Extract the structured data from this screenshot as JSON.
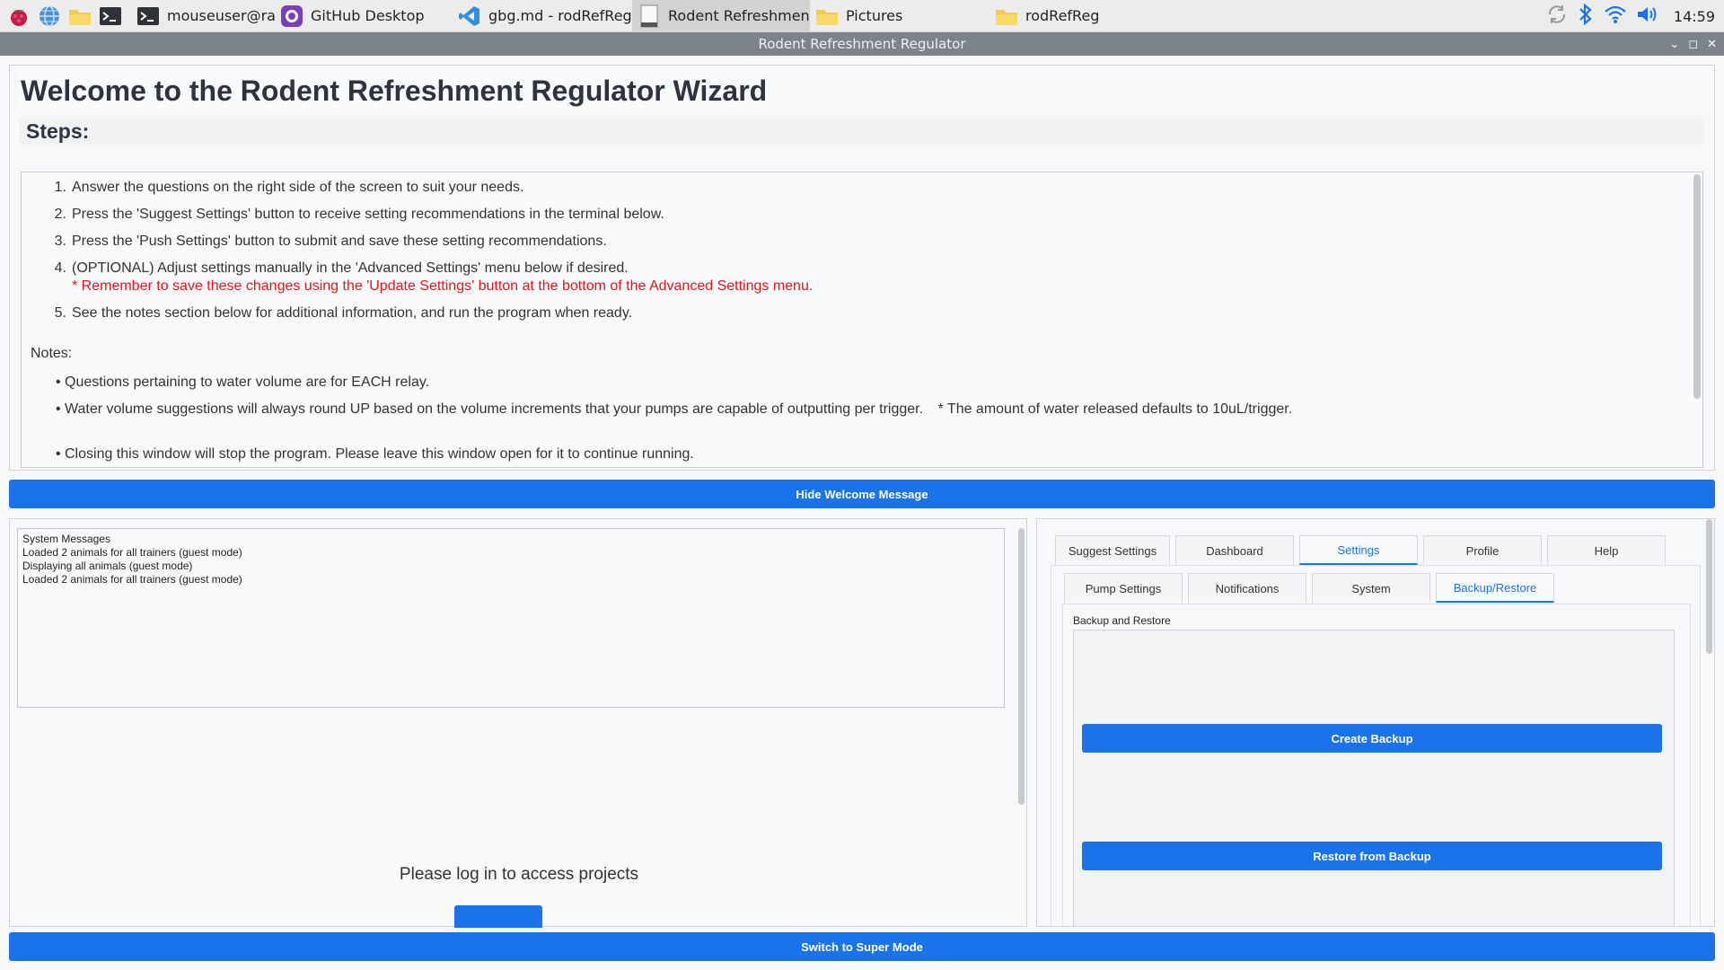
{
  "taskbar": {
    "tasks": [
      {
        "label": "mouseuser@raspber..",
        "icon": "terminal-icon"
      },
      {
        "label": "GitHub Desktop",
        "icon": "github-icon"
      },
      {
        "label": "gbg.md - rodRefReg ..",
        "icon": "vscode-icon"
      },
      {
        "label": "Rodent Refreshment ..",
        "icon": "window-icon"
      },
      {
        "label": "Pictures",
        "icon": "folder-icon"
      },
      {
        "label": "rodRefReg",
        "icon": "folder-icon"
      }
    ],
    "clock": "14:59",
    "accent": "#1a73e8"
  },
  "window": {
    "title": "Rodent Refreshment Regulator"
  },
  "welcome": {
    "title": "Welcome to the Rodent Refreshment Regulator Wizard",
    "steps_heading": "Steps:",
    "steps": [
      {
        "num": "1.",
        "text": "Answer the questions on the right side of the screen to suit your needs."
      },
      {
        "num": "2.",
        "text": "Press the 'Suggest Settings' button to receive setting recommendations in the terminal below."
      },
      {
        "num": "3.",
        "text": "Press the 'Push Settings' button to submit and save these setting recommendations."
      },
      {
        "num": "4.",
        "text": "(OPTIONAL) Adjust settings manually in the 'Advanced Settings' menu below if desired.",
        "warning": "* Remember to save these changes using the 'Update Settings' button at the bottom of the Advanced Settings menu."
      },
      {
        "num": "5.",
        "text": "See the notes section below for additional information, and run the program when ready."
      }
    ],
    "notes_label": "Notes:",
    "notes": [
      {
        "text": "Questions pertaining to water volume are for EACH relay."
      },
      {
        "text": "Water volume suggestions will always round UP based on the volume increments that your pumps are capable of outputting per trigger.",
        "info": "* The amount of water released defaults to 10uL/trigger."
      },
      {
        "text": "Closing this window will stop the program. Please leave this window open for it to continue running."
      }
    ],
    "hide_button": "Hide Welcome Message"
  },
  "system_messages": {
    "lines": [
      "System Messages",
      "Loaded 2 animals for all trainers (guest mode)",
      "Displaying all animals (guest mode)",
      "Loaded 2 animals for all trainers (guest mode)"
    ]
  },
  "projects": {
    "login_message": "Please log in to access projects"
  },
  "settings_panel": {
    "main_tabs": [
      "Suggest Settings",
      "Dashboard",
      "Settings",
      "Profile",
      "Help"
    ],
    "main_selected": "Settings",
    "sub_tabs": [
      "Pump Settings",
      "Notifications",
      "System",
      "Backup/Restore"
    ],
    "sub_selected": "Backup/Restore",
    "backup_label": "Backup and Restore",
    "create_backup": "Create Backup",
    "restore_backup": "Restore from Backup"
  },
  "footer": {
    "super_mode": "Switch to Super Mode"
  }
}
